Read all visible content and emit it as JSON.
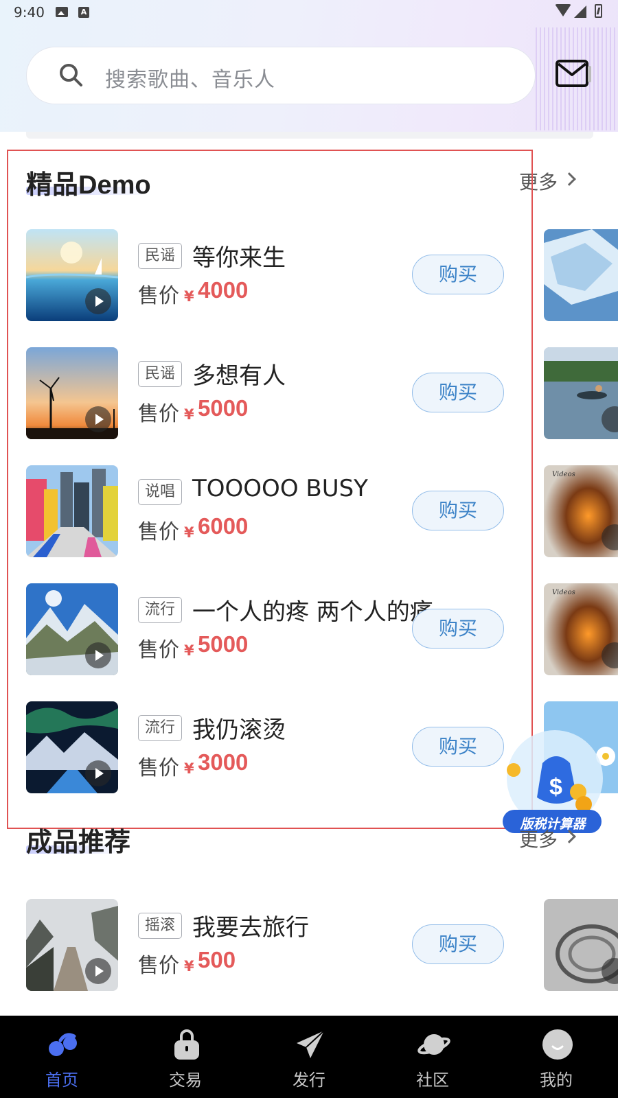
{
  "status_bar": {
    "time": "9:40"
  },
  "search": {
    "placeholder": "搜索歌曲、音乐人"
  },
  "featured": {
    "title": "精品Demo",
    "more_label": "更多",
    "items": [
      {
        "genre": "民谣",
        "name": "等你来生",
        "price_label": "售价",
        "currency": "¥",
        "price": "4000",
        "buy_label": "购买"
      },
      {
        "genre": "民谣",
        "name": "多想有人",
        "price_label": "售价",
        "currency": "¥",
        "price": "5000",
        "buy_label": "购买"
      },
      {
        "genre": "说唱",
        "name": "TOOOOO BUSY",
        "price_label": "售价",
        "currency": "¥",
        "price": "6000",
        "buy_label": "购买"
      },
      {
        "genre": "流行",
        "name": "一个人的疼 两个人的痛",
        "price_label": "售价",
        "currency": "¥",
        "price": "5000",
        "buy_label": "购买"
      },
      {
        "genre": "流行",
        "name": "我仍滚烫",
        "price_label": "售价",
        "currency": "¥",
        "price": "3000",
        "buy_label": "购买"
      }
    ]
  },
  "finished": {
    "title": "成品推荐",
    "more_label": "更多",
    "items": [
      {
        "genre": "摇滚",
        "name": "我要去旅行",
        "price_label": "售价",
        "currency": "¥",
        "price": "500",
        "buy_label": "购买"
      }
    ]
  },
  "widget": {
    "label": "版税计算器"
  },
  "tabs": [
    {
      "label": "首页",
      "icon": "home-icon",
      "active": true
    },
    {
      "label": "交易",
      "icon": "bag-icon",
      "active": false
    },
    {
      "label": "发行",
      "icon": "paper-plane-icon",
      "active": false
    },
    {
      "label": "社区",
      "icon": "planet-icon",
      "active": false
    },
    {
      "label": "我的",
      "icon": "smile-icon",
      "active": false
    }
  ],
  "colors": {
    "accent": "#4b6ff0",
    "price": "#e45a5a",
    "buy_border": "#93bde9",
    "frame": "#e05252"
  }
}
